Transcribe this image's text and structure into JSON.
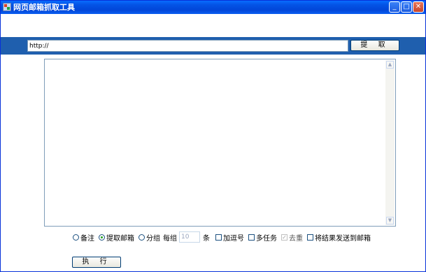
{
  "window": {
    "title": "网页邮箱抓取工具",
    "controls": {
      "minimize": "_",
      "maximize": "□",
      "close": "✕"
    }
  },
  "url_bar": {
    "value": "http://",
    "fetch_button": "提 取"
  },
  "output": {
    "text": "",
    "scroll_up": "▲",
    "scroll_down": "▼"
  },
  "options": {
    "radio_note": "备注",
    "radio_extract": "提取邮箱",
    "radio_group": "分组",
    "per_group_label": "每组",
    "per_group_value": "10",
    "per_group_unit": "条",
    "check_add_sep": "加逗号",
    "check_multitask": "多任务",
    "check_dedupe": "去重",
    "check_dedupe_mark": "✓",
    "check_send": "将结果发送到邮箱"
  },
  "run_button": "执 行",
  "colors": {
    "titlebar": "#0454e6",
    "strip": "#1f5fae"
  }
}
